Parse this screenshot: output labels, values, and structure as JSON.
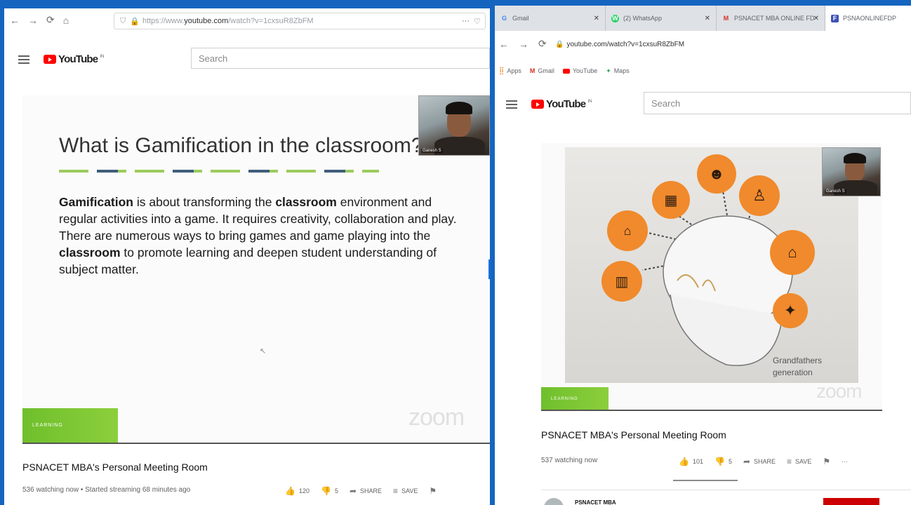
{
  "left_window": {
    "url": "https://www.youtube.com/watch?v=1cxsuR8ZbFM",
    "url_prefix": "https://www.",
    "url_domain": "youtube.com",
    "url_rest": "/watch?v=1cxsuR8ZbFM",
    "more_glyph": "···",
    "youtube": {
      "word": "YouTube",
      "region": "IN",
      "search_placeholder": "Search"
    },
    "slide": {
      "heading": "What is Gamification in the classroom?",
      "p1_bold": "Gamification",
      "p1_a": " is about transforming the ",
      "p1_bold2": "classroom",
      "p1_b": " environment and regular activities into a game. It requires creativity, collaboration and play. There are numerous ways to bring games and game playing into the ",
      "p1_bold3": "classroom",
      "p1_c": " to promote learning and deepen student understanding of subject matter.",
      "zoom_mark": "zoom",
      "green_label": "LEARNING",
      "cam_name": "Ganesh S"
    },
    "video": {
      "title": "PSNACET MBA's Personal Meeting Room",
      "meta": "536 watching now • Started streaming 68 minutes ago",
      "likes": "120",
      "dislikes": "5",
      "share": "SHARE",
      "save": "SAVE"
    }
  },
  "right_window": {
    "tabs": [
      {
        "label": "Gmail",
        "icon": "G",
        "color": "#4285f4"
      },
      {
        "label": "(2) WhatsApp",
        "icon": "W",
        "color": "#25d366"
      },
      {
        "label": "PSNACET MBA ONLINE FD",
        "icon": "M",
        "color": "#d93025"
      },
      {
        "label": "PSNAONLINEFDP",
        "icon": "F",
        "color": "#3f51b5"
      }
    ],
    "url": "youtube.com/watch?v=1cxsuR8ZbFM",
    "bookmarks": [
      "Apps",
      "Gmail",
      "YouTube",
      "Maps"
    ],
    "youtube": {
      "word": "YouTube",
      "region": "IN",
      "search_placeholder": "Search"
    },
    "slide": {
      "caption_line1": "Grandfathers",
      "caption_line2": "generation",
      "zoom_mark": "zoom",
      "green_label": "LEARNING",
      "cam_name": "Ganesh S"
    },
    "video": {
      "title": "PSNACET MBA's Personal Meeting Room",
      "meta": "537 watching now",
      "likes": "101",
      "dislikes": "5",
      "share": "SHARE",
      "save": "SAVE",
      "more": "···",
      "channel": "PSNACET MBA"
    }
  },
  "colors": {
    "frame": "#1565c0",
    "accent_orange": "#f08a2c",
    "youtube_red": "#ff0000",
    "learning_green": "#6fbf2c"
  }
}
